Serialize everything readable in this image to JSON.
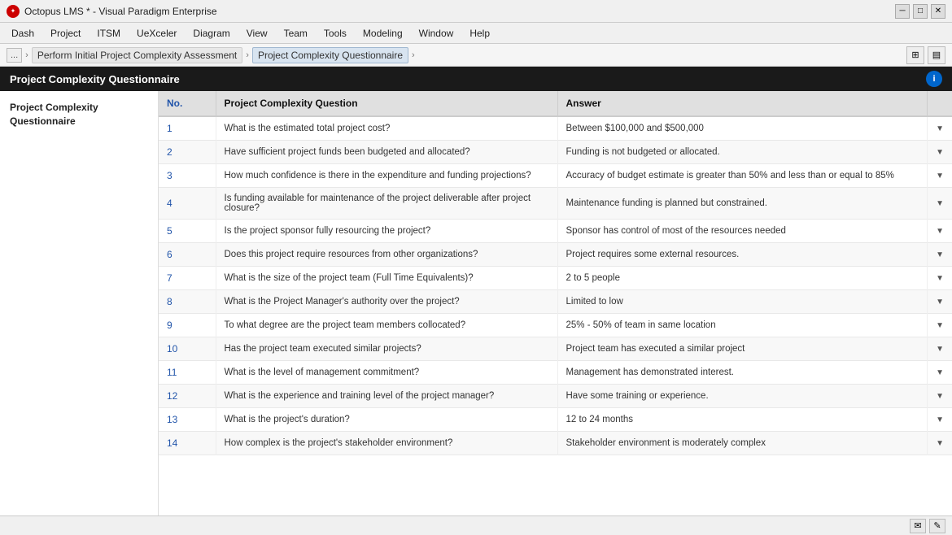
{
  "titleBar": {
    "title": "Octopus LMS * - Visual Paradigm Enterprise",
    "minBtn": "─",
    "maxBtn": "□",
    "closeBtn": "✕"
  },
  "menuBar": {
    "items": [
      "Dash",
      "Project",
      "ITSM",
      "UeXceler",
      "Diagram",
      "View",
      "Team",
      "Tools",
      "Modeling",
      "Window",
      "Help"
    ]
  },
  "breadcrumb": {
    "dots": "...",
    "path1": "Perform Initial Project Complexity Assessment",
    "path2": "Project Complexity Questionnaire"
  },
  "panelHeader": {
    "title": "Project Complexity Questionnaire",
    "icon": "i"
  },
  "sidebar": {
    "title": "Project Complexity Questionnaire"
  },
  "table": {
    "columns": [
      "No.",
      "Project Complexity Question",
      "Answer"
    ],
    "rows": [
      {
        "no": "1",
        "question": "What is the estimated total project cost?",
        "answer": "Between $100,000 and $500,000"
      },
      {
        "no": "2",
        "question": "Have sufficient project funds been budgeted and allocated?",
        "answer": "Funding is not budgeted or allocated."
      },
      {
        "no": "3",
        "question": "How much confidence is there in the expenditure and funding projections?",
        "answer": "Accuracy of budget estimate is greater than 50% and less than or equal to 85%"
      },
      {
        "no": "4",
        "question": "Is funding available for maintenance of the project deliverable after project closure?",
        "answer": "Maintenance funding is planned but constrained."
      },
      {
        "no": "5",
        "question": "Is the project sponsor fully resourcing the project?",
        "answer": "Sponsor has control of most of the resources needed"
      },
      {
        "no": "6",
        "question": "Does this project require resources from other organizations?",
        "answer": "Project requires some external resources."
      },
      {
        "no": "7",
        "question": "What is the size of the project team (Full Time Equivalents)?",
        "answer": "2 to 5 people"
      },
      {
        "no": "8",
        "question": "What is the Project Manager's authority over the project?",
        "answer": "Limited to low"
      },
      {
        "no": "9",
        "question": "To what degree are the project team members collocated?",
        "answer": "25% - 50% of team in same location"
      },
      {
        "no": "10",
        "question": "Has the project team executed similar projects?",
        "answer": "Project team has executed a similar project"
      },
      {
        "no": "11",
        "question": "What is the level of management commitment?",
        "answer": "Management has demonstrated interest."
      },
      {
        "no": "12",
        "question": "What is the experience and training level of the project manager?",
        "answer": "Have some training or experience."
      },
      {
        "no": "13",
        "question": "What is the project's duration?",
        "answer": "12 to 24 months"
      },
      {
        "no": "14",
        "question": "How complex is the project's stakeholder environment?",
        "answer": "Stakeholder environment is moderately complex"
      }
    ]
  },
  "statusBar": {
    "mailIcon": "✉",
    "editIcon": "✎"
  }
}
